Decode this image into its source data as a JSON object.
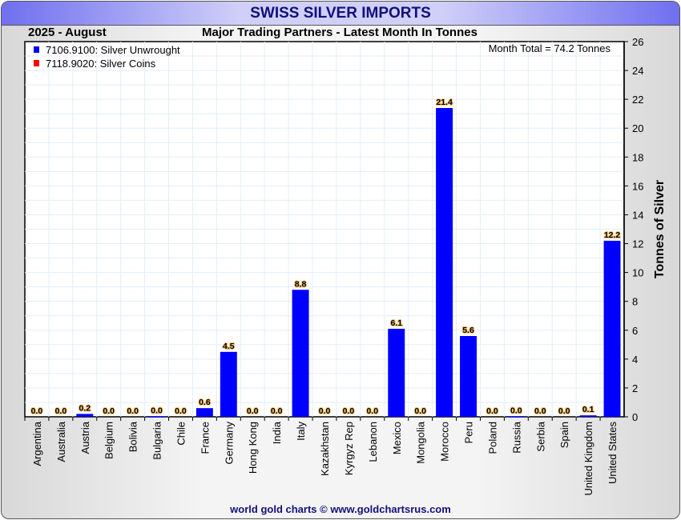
{
  "title": "SWISS SILVER IMPORTS",
  "period": "2025 - August",
  "subtitle": "Major Trading Partners - Latest Month In Tonnes",
  "footer": "world gold charts © www.goldchartsrus.com",
  "chart_data": {
    "type": "bar",
    "title": "SWISS SILVER IMPORTS",
    "ylabel": "Tonnes of Silver",
    "ylim": [
      0,
      26
    ],
    "yticks": [
      0,
      2,
      4,
      6,
      8,
      10,
      12,
      14,
      16,
      18,
      20,
      22,
      24,
      26
    ],
    "annotation": "Month Total = 74.2 Tonnes",
    "legend": [
      {
        "label": "7106.9100: Silver Unwrought",
        "color": "#0000ff"
      },
      {
        "label": "7118.9020: Silver Coins",
        "color": "#ff0000"
      }
    ],
    "legend_position": "top-left",
    "categories": [
      "Argentina",
      "Australia",
      "Austria",
      "Belgium",
      "Bolivia",
      "Bulgaria",
      "Chile",
      "France",
      "Germany",
      "Hong Kong",
      "India",
      "Italy",
      "Kazakhstan",
      "Kyrgyz Rep",
      "Lebanon",
      "Mexico",
      "Mongolia",
      "Morocco",
      "Peru",
      "Poland",
      "Russia",
      "Serbia",
      "Spain",
      "United Kingdom",
      "United States"
    ],
    "values": [
      0.0,
      0.0,
      0.2,
      0.0,
      0.0,
      0.04,
      0.0,
      0.6,
      4.5,
      0.0,
      0.0,
      8.8,
      0.0,
      0.0,
      0.0,
      6.1,
      0.0,
      21.4,
      5.6,
      0.0,
      0.04,
      0.0,
      0.0,
      0.1,
      12.2
    ],
    "labels": [
      "0.0",
      "0.0",
      "0.2",
      "0.0",
      "0.0",
      "0.0",
      "0.0",
      "0.6",
      "4.5",
      "0.0",
      "0.0",
      "8.8",
      "0.0",
      "0.0",
      "0.0",
      "6.1",
      "0.0",
      "21.4",
      "5.6",
      "0.0",
      "0.0",
      "0.0",
      "0.0",
      "0.1",
      "12.2"
    ]
  }
}
